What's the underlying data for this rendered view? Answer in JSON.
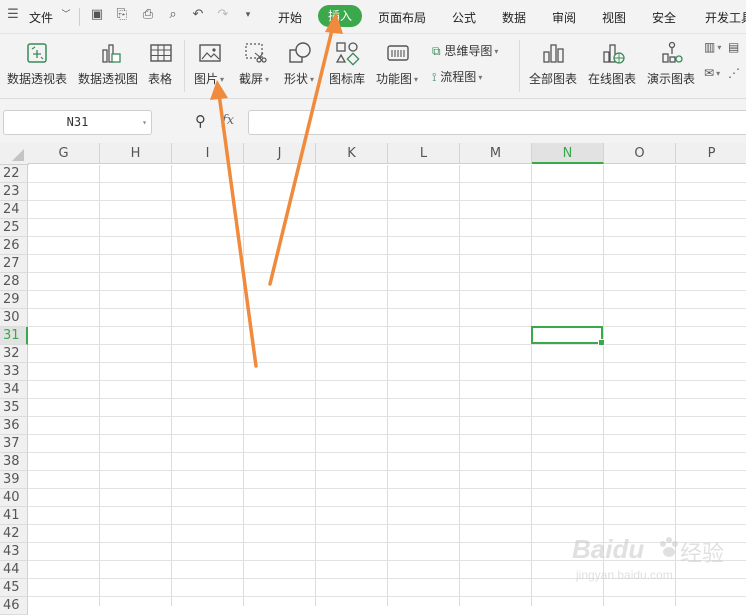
{
  "menubar": {
    "file_label": "文件",
    "tabs": [
      "开始",
      "插入",
      "页面布局",
      "公式",
      "数据",
      "审阅",
      "视图",
      "安全",
      "开发工具"
    ],
    "active_tab": "插入"
  },
  "ribbon": {
    "pivot_table": "数据透视表",
    "pivot_chart": "数据透视图",
    "table": "表格",
    "picture": "图片",
    "screenshot": "截屏",
    "shapes": "形状",
    "icon_library": "图标库",
    "function_chart": "功能图",
    "mind_map": "思维导图",
    "flowchart": "流程图",
    "all_charts": "全部图表",
    "online_charts": "在线图表",
    "demo_charts": "演示图表"
  },
  "formula_bar": {
    "name_box": "N31",
    "fx_label": "fx",
    "formula_value": ""
  },
  "grid": {
    "columns": [
      "G",
      "H",
      "I",
      "J",
      "K",
      "L",
      "M",
      "N",
      "O",
      "P"
    ],
    "selected_column": "N",
    "rows": [
      "22",
      "23",
      "24",
      "25",
      "26",
      "27",
      "28",
      "29",
      "30",
      "31",
      "32",
      "33",
      "34",
      "35",
      "36",
      "37",
      "38",
      "39",
      "40",
      "41",
      "42",
      "43",
      "44",
      "45",
      "46"
    ],
    "selected_row": "31"
  },
  "colors": {
    "accent": "#3aa84b",
    "arrow": "#f08a3c",
    "chrome": "#f3f3f3"
  },
  "watermark": {
    "brand": "Baidu",
    "brand_cn": "经验",
    "url": "jingyan.baidu.com"
  }
}
